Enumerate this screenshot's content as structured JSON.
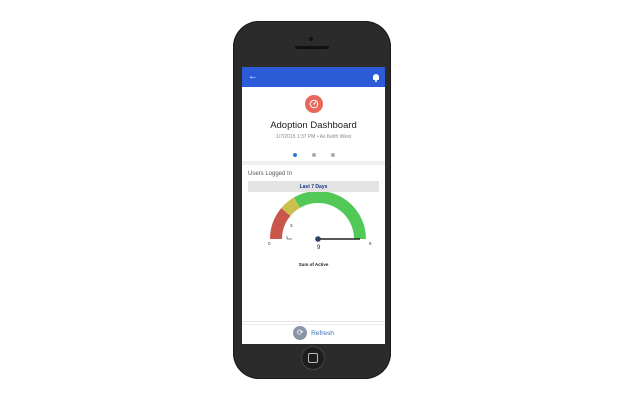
{
  "app": {
    "back_icon": "arrow-left-icon",
    "notification_icon": "bell-icon",
    "accent": "#2c5bd8"
  },
  "header": {
    "icon": "speedometer-icon",
    "icon_color": "#e8665a",
    "title": "Adoption Dashboard",
    "subtitle": "1/7/2015 1:37 PM  •  As Keith West",
    "page_dots": 3,
    "active_dot": 0
  },
  "widget": {
    "title": "Users Logged In",
    "filter": "Last 7 Days",
    "gauge": {
      "min_label": "0",
      "max_label": "9",
      "mid_label": "3",
      "value_label": "9",
      "measure_label": "Sum of Active",
      "bands": [
        {
          "from": 0,
          "to": 2,
          "color": "#c9564a"
        },
        {
          "from": 2,
          "to": 3,
          "color": "#cbbf4e"
        },
        {
          "from": 3,
          "to": 9,
          "color": "#52c957"
        }
      ],
      "value": 9,
      "range": [
        0,
        9
      ]
    }
  },
  "footer": {
    "refresh_icon": "refresh-icon",
    "refresh_label": "Refresh"
  }
}
